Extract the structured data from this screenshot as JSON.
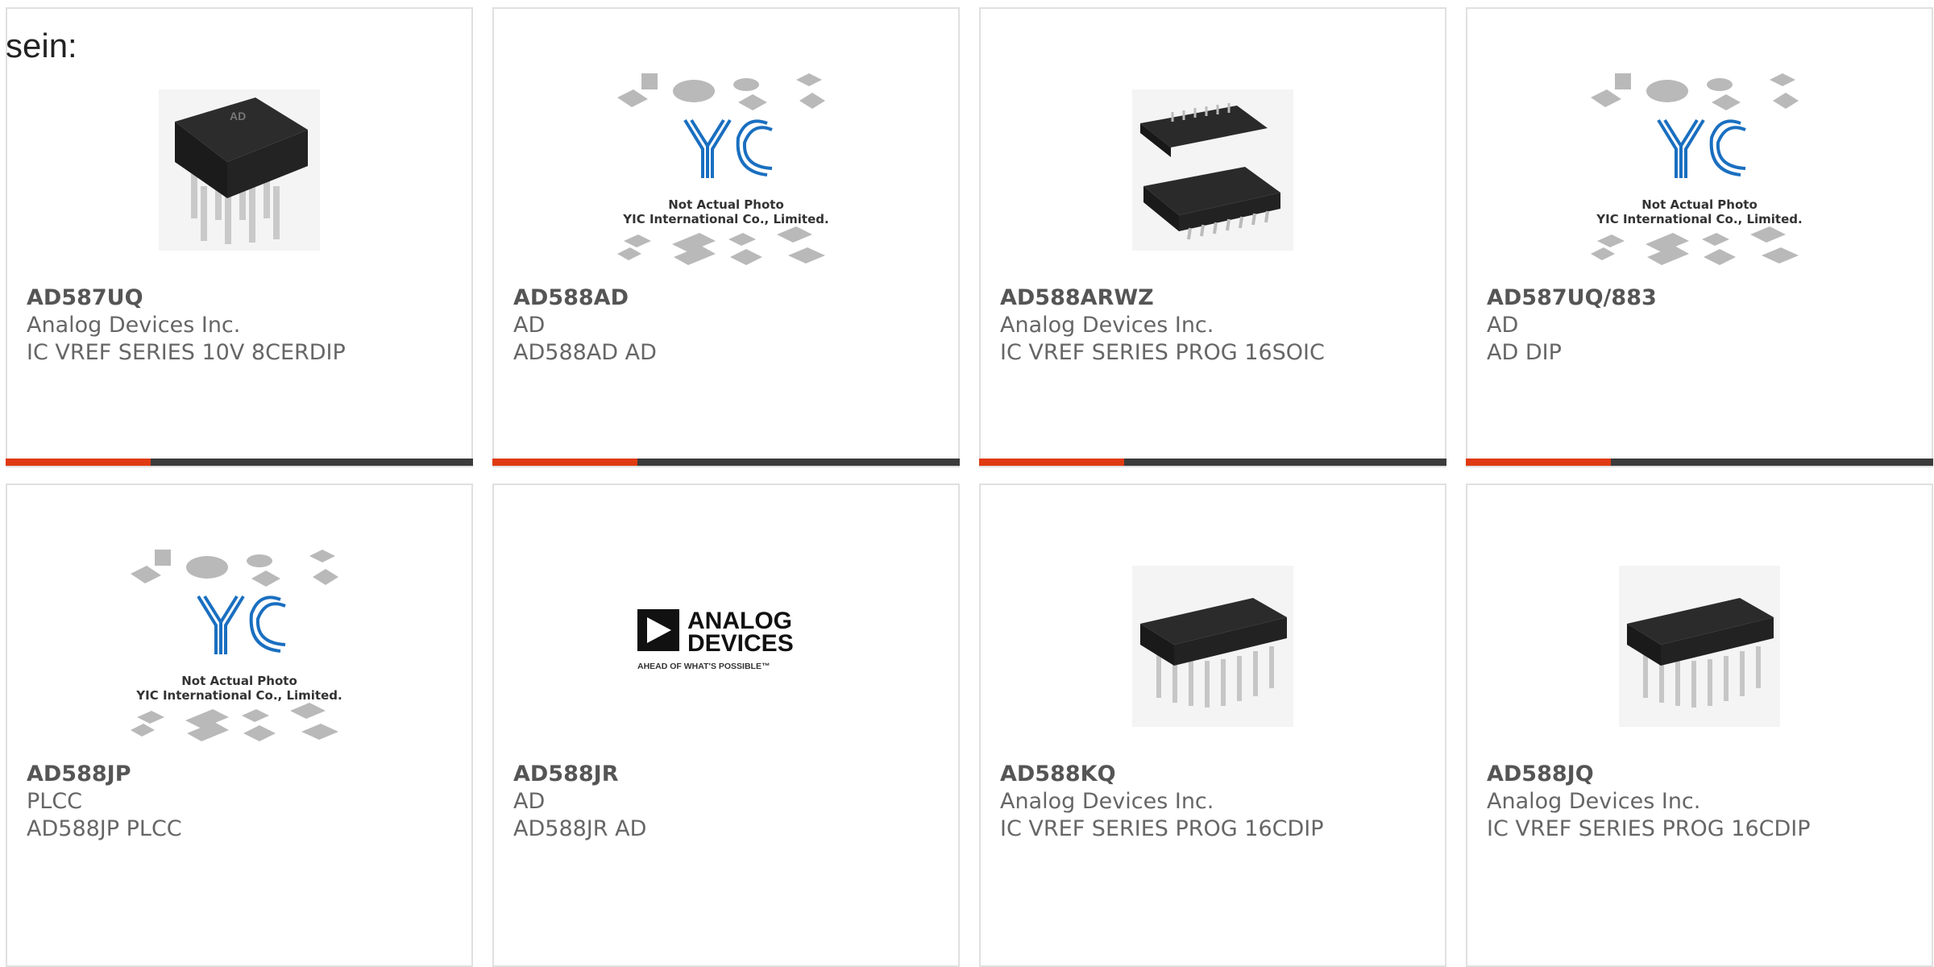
{
  "intro_text": "sein:",
  "colors": {
    "accent": "#e03a12",
    "bar": "#3b3b3b",
    "yic_blue": "#1a6fc0"
  },
  "products": [
    {
      "part": "AD587UQ",
      "line1": "Analog Devices Inc.",
      "line2": "IC VREF SERIES 10V 8CERDIP",
      "image": "dip8-cerdip-chip-photo",
      "image_label": "AD",
      "bar_fill": 0.31
    },
    {
      "part": "AD588AD",
      "line1": "AD",
      "line2": "AD588AD AD",
      "image": "yic-placeholder",
      "image_caption1": "Not Actual Photo",
      "image_caption2": "YIC International Co., Limited.",
      "bar_fill": 0.31
    },
    {
      "part": "AD588ARWZ",
      "line1": "Analog Devices Inc.",
      "line2": "IC VREF SERIES PROG 16SOIC",
      "image": "soic16-chip-photo",
      "bar_fill": 0.31
    },
    {
      "part": "AD587UQ/883",
      "line1": "AD",
      "line2": "AD DIP",
      "image": "yic-placeholder",
      "image_caption1": "Not Actual Photo",
      "image_caption2": "YIC International Co., Limited.",
      "bar_fill": 0.31
    },
    {
      "part": "AD588JP",
      "line1": "PLCC",
      "line2": "AD588JP PLCC",
      "image": "yic-placeholder",
      "image_caption1": "Not Actual Photo",
      "image_caption2": "YIC International Co., Limited."
    },
    {
      "part": "AD588JR",
      "line1": "AD",
      "line2": "AD588JR AD",
      "image": "analog-devices-logo",
      "logo_line1": "ANALOG",
      "logo_line2": "DEVICES",
      "logo_tagline": "AHEAD OF WHAT'S POSSIBLE™"
    },
    {
      "part": "AD588KQ",
      "line1": "Analog Devices Inc.",
      "line2": "IC VREF SERIES PROG 16CDIP",
      "image": "dip16-cdip-chip-photo"
    },
    {
      "part": "AD588JQ",
      "line1": "Analog Devices Inc.",
      "line2": "IC VREF SERIES PROG 16CDIP",
      "image": "dip16-cdip-chip-photo"
    }
  ]
}
